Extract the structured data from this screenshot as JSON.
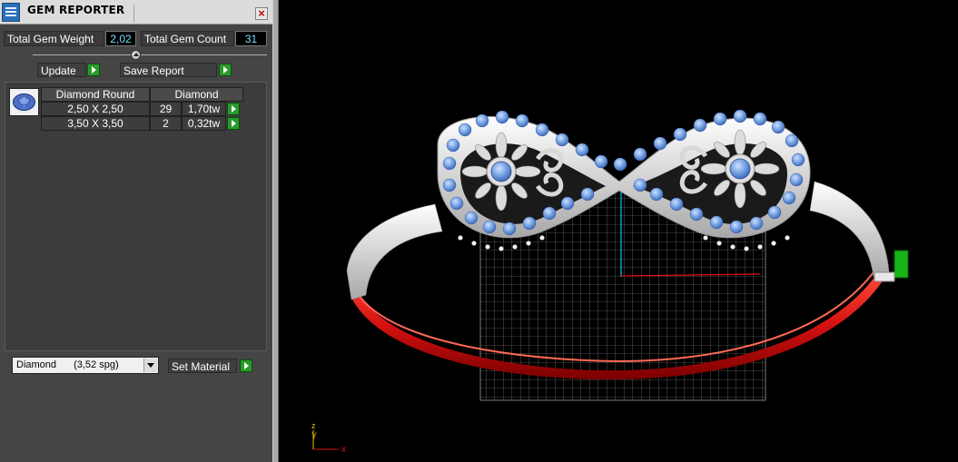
{
  "window": {
    "title": "GEM REPORTER"
  },
  "stats": {
    "weight_label": "Total Gem Weight",
    "weight_value": "2,02",
    "count_label": "Total Gem Count",
    "count_value": "31"
  },
  "actions": {
    "update_label": "Update",
    "save_label": "Save Report"
  },
  "gem_table": {
    "headers": [
      "Diamond Round",
      "Diamond"
    ],
    "rows": [
      {
        "size": "2,50 X 2,50",
        "count": "29",
        "weight": "1,70tw"
      },
      {
        "size": "3,50 X 3,50",
        "count": "2",
        "weight": "0,32tw"
      }
    ]
  },
  "material": {
    "selected": "Diamond",
    "density": "(3,52 spg)",
    "set_label": "Set Material"
  },
  "viewport": {
    "axis_z": "z",
    "axis_y": "Y",
    "axis_x": "x"
  },
  "colors": {
    "panel_bg": "#454545",
    "value_text": "#6fe0ff",
    "play_green": "#2a9a2a",
    "ring_red": "#d41010",
    "metal": "#e6e6e6",
    "gem_blue": "#6f9fe0"
  },
  "icons": [
    "gem-reporter-icon",
    "close-icon",
    "slider-knob-icon",
    "gem-thumbnail-icon",
    "dropdown-arrow-icon",
    "play-arrow-icon"
  ]
}
